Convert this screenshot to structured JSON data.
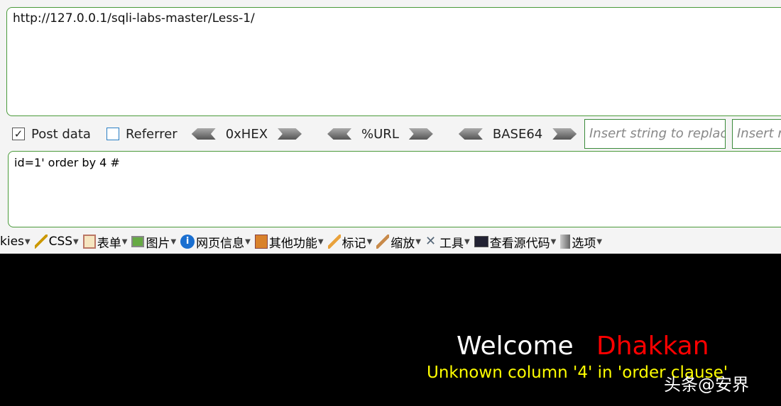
{
  "url": "http://127.0.0.1/sqli-labs-master/Less-1/",
  "toolbar": {
    "post_data": "Post data",
    "post_checked": true,
    "referrer": "Referrer",
    "referrer_checked": false,
    "hex": "0xHEX",
    "url": "%URL",
    "base64": "BASE64",
    "replace_placeholder": "Insert string to replace",
    "replace_with_placeholder": "Insert replacing string"
  },
  "post_body": "id=1' order by 4 #",
  "menu": [
    "kies",
    "CSS",
    "表单",
    "图片",
    "网页信息",
    "其他功能",
    "标记",
    "缩放",
    "工具",
    "查看源代码",
    "选项"
  ],
  "output": {
    "welcome": "Welcome",
    "name": "Dhakkan",
    "error": "Unknown column '4' in 'order clause'"
  },
  "watermark": "头条@安界",
  "colors": {
    "border": "#4a9a3a",
    "name": "#ff0000",
    "error": "#ffff00"
  }
}
